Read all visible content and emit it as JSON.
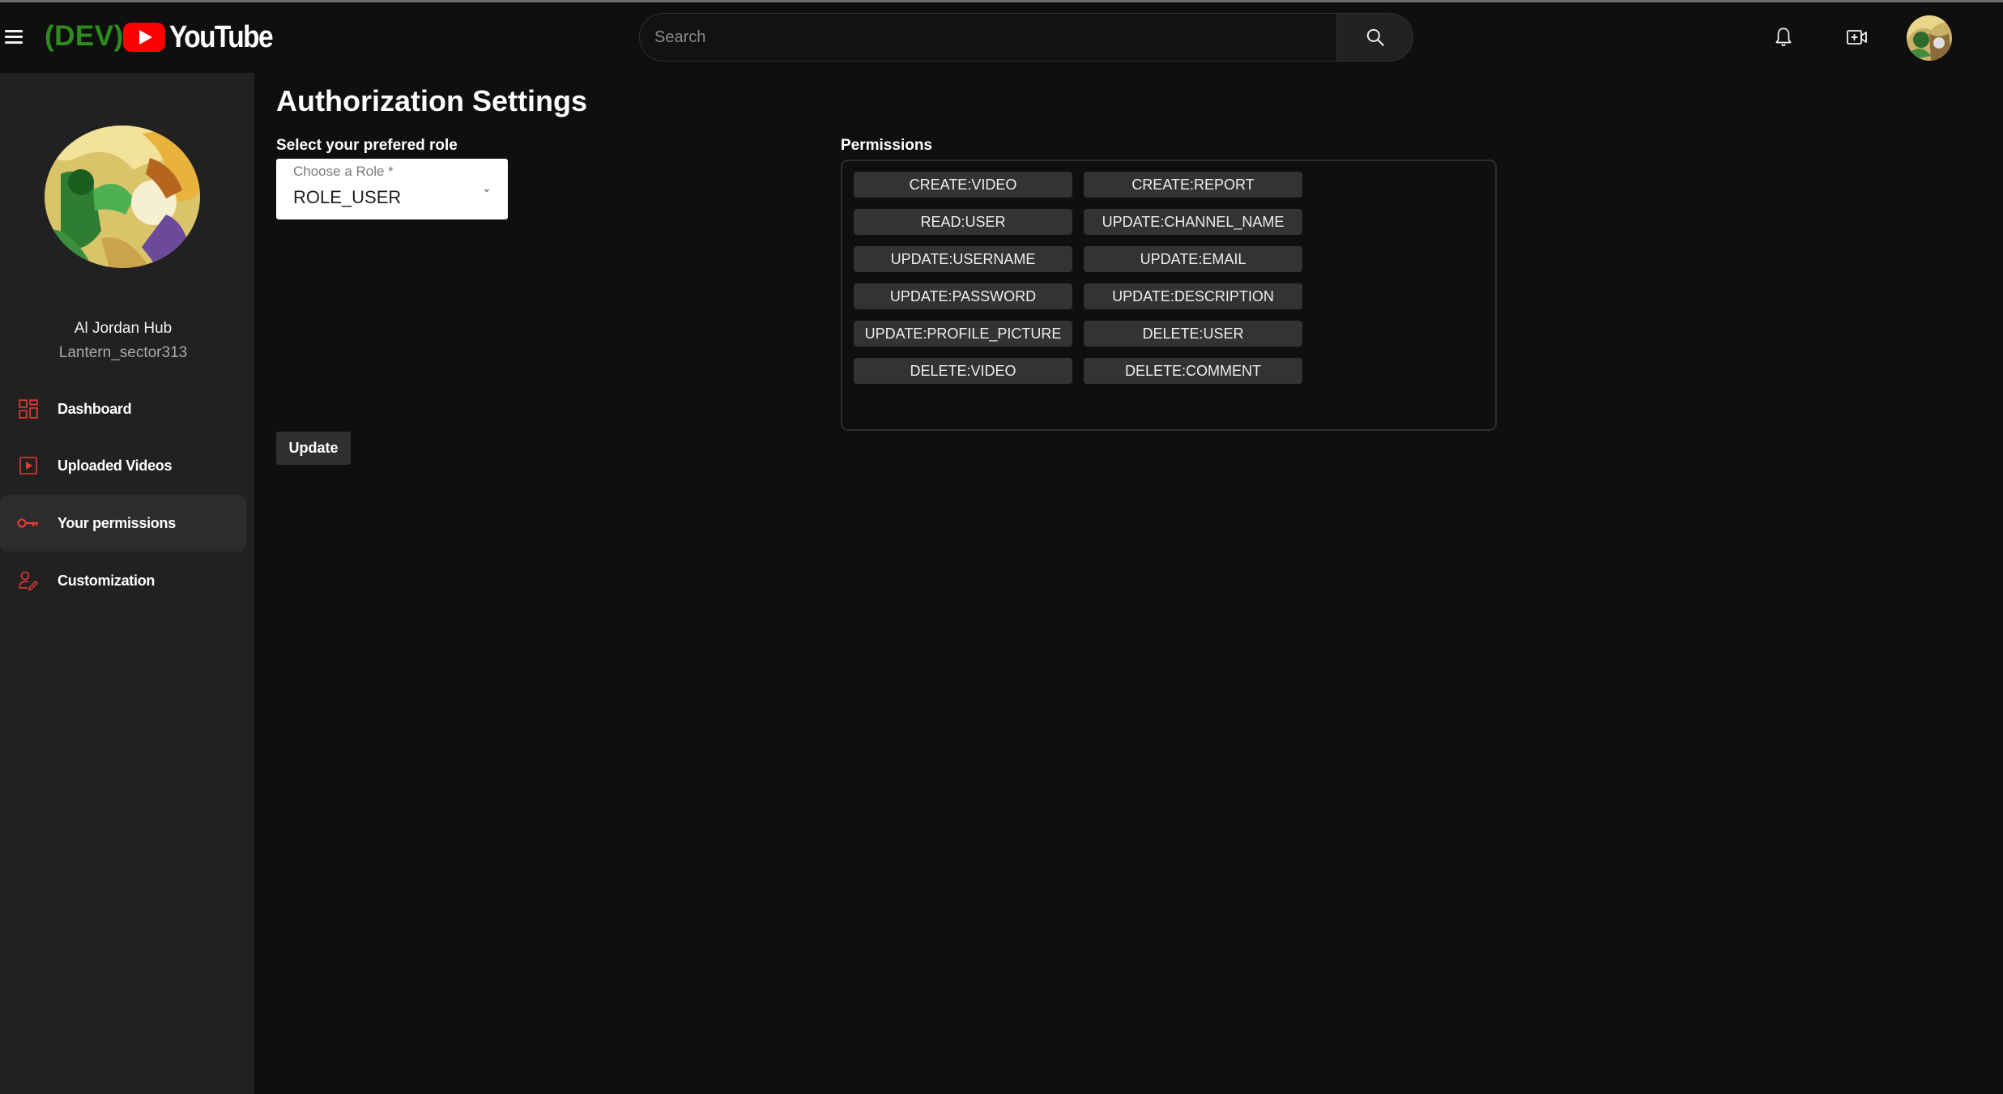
{
  "header": {
    "env_tag": "(DEV)",
    "logo_text": "YouTube",
    "search_placeholder": "Search",
    "icons": [
      "menu-icon",
      "search-icon",
      "bell-icon",
      "create-video-icon",
      "avatar"
    ]
  },
  "sidebar": {
    "profile_name": "Al Jordan Hub",
    "profile_handle": "Lantern_sector313",
    "items": [
      {
        "label": "Dashboard",
        "icon": "dashboard-icon",
        "active": false
      },
      {
        "label": "Uploaded Videos",
        "icon": "play-box-icon",
        "active": false
      },
      {
        "label": "Your permissions",
        "icon": "key-icon",
        "active": true
      },
      {
        "label": "Customization",
        "icon": "person-edit-icon",
        "active": false
      }
    ]
  },
  "main": {
    "title": "Authorization Settings",
    "role_label": "Select your prefered role",
    "role_select": {
      "floating_label": "Choose a Role *",
      "value": "ROLE_USER"
    },
    "permissions_label": "Permissions",
    "permissions": [
      "CREATE:VIDEO",
      "CREATE:REPORT",
      "READ:USER",
      "UPDATE:CHANNEL_NAME",
      "UPDATE:USERNAME",
      "UPDATE:EMAIL",
      "UPDATE:PASSWORD",
      "UPDATE:DESCRIPTION",
      "UPDATE:PROFILE_PICTURE",
      "DELETE:USER",
      "DELETE:VIDEO",
      "DELETE:COMMENT"
    ],
    "update_button": "Update"
  },
  "colors": {
    "background": "#0f0f0f",
    "sidebar": "#212121",
    "accent_red": "#ff0000",
    "dev_green": "#2e8b1f",
    "nav_icon_red": "#e53935"
  }
}
